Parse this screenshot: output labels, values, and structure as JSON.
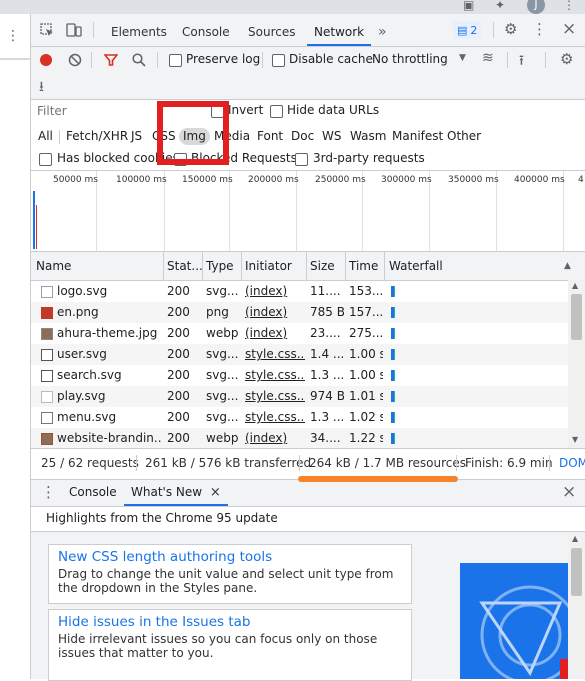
{
  "browser": {
    "avatar_letter": "J"
  },
  "devtools": {
    "tabs": [
      "Elements",
      "Console",
      "Sources",
      "Network"
    ],
    "more_tabs": "»",
    "issues_count": "2"
  },
  "toolbar": {
    "preserve_log": "Preserve log",
    "disable_cache": "Disable cache",
    "throttling": "No throttling"
  },
  "filter": {
    "placeholder": "Filter",
    "invert": "Invert",
    "hide_data_urls": "Hide data URLs"
  },
  "types": [
    "All",
    "Fetch/XHR",
    "JS",
    "CSS",
    "Img",
    "Media",
    "Font",
    "Doc",
    "WS",
    "Wasm",
    "Manifest",
    "Other"
  ],
  "blocked": {
    "has_blocked_cookies": "Has blocked cookies",
    "blocked_requests": "Blocked Requests",
    "third_party": "3rd-party requests"
  },
  "overview_ticks": [
    "50000 ms",
    "100000 ms",
    "150000 ms",
    "200000 ms",
    "250000 ms",
    "300000 ms",
    "350000 ms",
    "400000 ms",
    "4"
  ],
  "table": {
    "headers": [
      "Name",
      "Stat...",
      "Type",
      "Initiator",
      "Size",
      "Time",
      "Waterfall"
    ],
    "rows": [
      {
        "name": "logo.svg",
        "status": "200",
        "type": "svg...",
        "initiator": "(index)",
        "size": "11....",
        "time": "153...."
      },
      {
        "name": "en.png",
        "status": "200",
        "type": "png",
        "initiator": "(index)",
        "size": "785 B",
        "time": "157...."
      },
      {
        "name": "ahura-theme.jpg",
        "status": "200",
        "type": "webp",
        "initiator": "(index)",
        "size": "23....",
        "time": "275...."
      },
      {
        "name": "user.svg",
        "status": "200",
        "type": "svg...",
        "initiator": "style.css...",
        "size": "1.4 ...",
        "time": "1.00 s"
      },
      {
        "name": "search.svg",
        "status": "200",
        "type": "svg...",
        "initiator": "style.css...",
        "size": "1.3 ...",
        "time": "1.00 s"
      },
      {
        "name": "play.svg",
        "status": "200",
        "type": "svg...",
        "initiator": "style.css...",
        "size": "974 B",
        "time": "1.01 s"
      },
      {
        "name": "menu.svg",
        "status": "200",
        "type": "svg...",
        "initiator": "style.css...",
        "size": "1.3 ...",
        "time": "1.02 s"
      },
      {
        "name": "website-brandin...",
        "status": "200",
        "type": "webp",
        "initiator": "(index)",
        "size": "34....",
        "time": "1.22 s"
      }
    ]
  },
  "status": {
    "requests": "25 / 62 requests",
    "transferred": "261 kB / 576 kB transferred",
    "resources": "264 kB / 1.7 MB resources",
    "finish": "Finish: 6.9 min",
    "dom": "DOM"
  },
  "drawer": {
    "tabs": [
      "Console",
      "What's New"
    ],
    "close": "×",
    "highlights": "Highlights from the Chrome 95 update",
    "cards": [
      {
        "title": "New CSS length authoring tools",
        "desc": "Drag to change the unit value and select unit type from the dropdown in the Styles pane."
      },
      {
        "title": "Hide issues in the Issues tab",
        "desc": "Hide irrelevant issues so you can focus only on those issues that matter to you."
      }
    ]
  },
  "colors": {
    "accent": "#1a73e8",
    "record": "#d93025",
    "annotation_red": "#e32020",
    "annotation_orange": "#f7842b"
  }
}
